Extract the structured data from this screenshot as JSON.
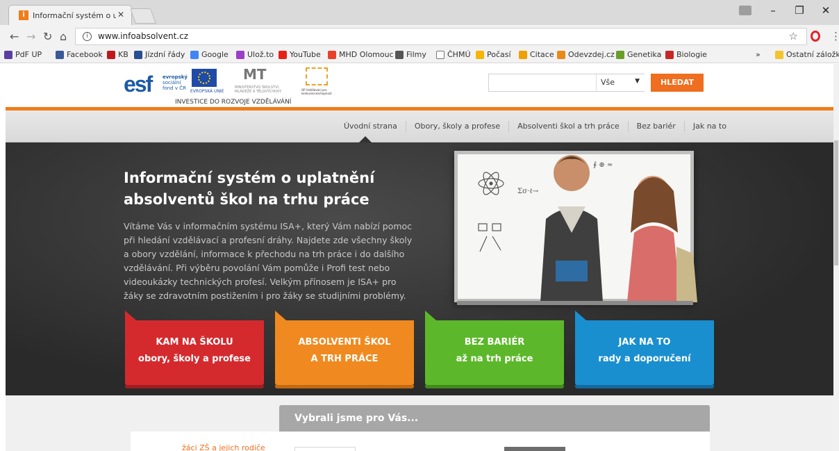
{
  "browser": {
    "tab_title": "Informační systém o upla",
    "url": "www.infoabsolvent.cz",
    "bookmarks": [
      "PdF UP",
      "Facebook",
      "KB",
      "Jízdní řády",
      "Google",
      "Ulož.to",
      "YouTube",
      "MHD Olomouc",
      "Filmy",
      "ČHMÚ",
      "Počasí",
      "Citace",
      "Odevzdej.cz",
      "Genetika",
      "Biologie"
    ],
    "bookmarks_more": "»",
    "other_bookmarks": "Ostatní záložky"
  },
  "header": {
    "esf_line1": "evropský",
    "esf_line2": "sociální",
    "esf_line3": "fond v ČR",
    "eu_label": "EVROPSKÁ UNIE",
    "msmt_label": "MINISTERSTVO ŠKOLSTVÍ, MLÁDEŽE A TĚLOVÝCHOVY",
    "op_label": "OP Vzdělávání pro konkurenceschopnost",
    "invest_label": "INVESTICE DO ROZVOJE VZDĚLÁVÁNÍ",
    "search_select_value": "Vše",
    "search_button": "HLEDAT"
  },
  "nav": {
    "items": [
      "Úvodní strana",
      "Obory, školy a profese",
      "Absolventi škol a trh práce",
      "Bez bariér",
      "Jak na to"
    ]
  },
  "hero": {
    "title": "Informační systém o uplatnění absolventů škol na trhu práce",
    "text": "Vítáme Vás v informačním systému ISA+, který Vám nabízí pomoc při hledání vzdělávací a profesní dráhy. Najdete zde všechny školy a obory vzdělání, informace k přechodu na trh práce i do dalšího vzdělávání. Při výběru povolání Vám pomůže i Profi test nebo videoukázky technických profesí. Velkým přínosem je ISA+ pro žáky se zdravotním postižením i pro žáky se studijními problémy."
  },
  "tiles": [
    {
      "line1": "KAM NA ŠKOLU",
      "line2": "obory, školy a profese",
      "color": "#d42a2e",
      "shade": "#9e1e22"
    },
    {
      "line1": "ABSOLVENTI ŠKOL",
      "line2": "A TRH PRÁCE",
      "color": "#f08a20",
      "shade": "#c26a12"
    },
    {
      "line1": "BEZ BARIÉR",
      "line2": "až na trh práce",
      "color": "#5cb82a",
      "shade": "#3f8a1b"
    },
    {
      "line1": "JAK NA TO",
      "line2": "rady a doporučení",
      "color": "#1a8fd0",
      "shade": "#136aa0"
    }
  ],
  "picks": {
    "heading": "Vybrali jsme pro Vás...",
    "audience_label": "žáci ZŠ a jejich rodiče"
  },
  "colors": {
    "accent_orange": "#ef7d1a",
    "hero_bg": "#2f2f2f"
  }
}
